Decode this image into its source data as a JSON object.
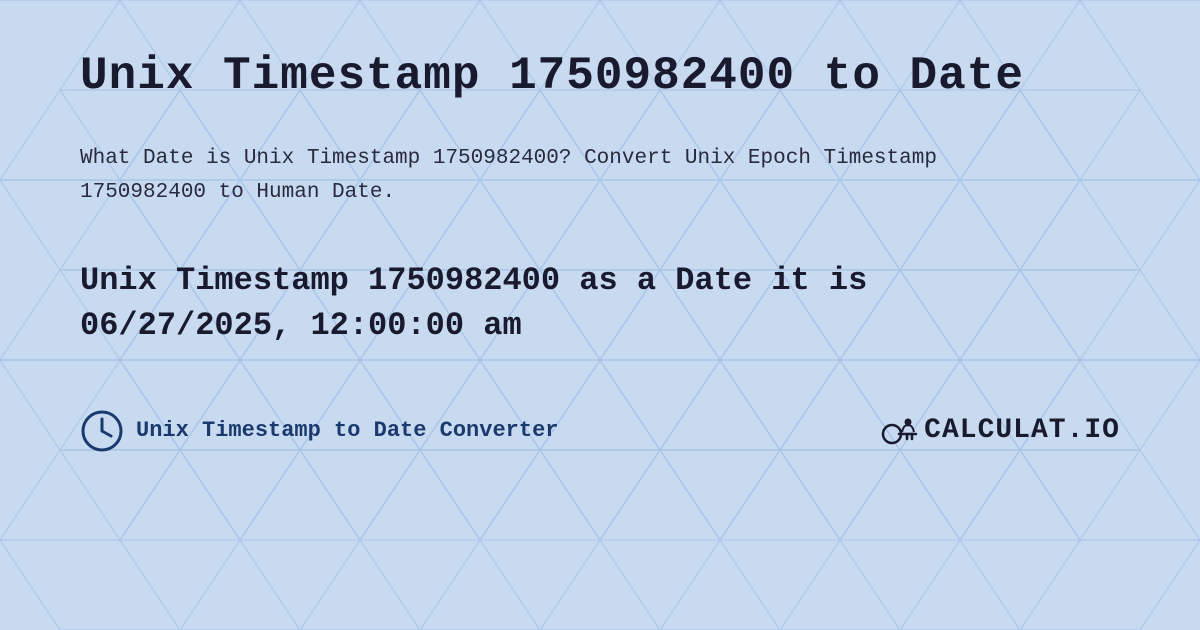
{
  "page": {
    "title": "Unix Timestamp 1750982400 to Date",
    "description": "What Date is Unix Timestamp 1750982400? Convert Unix Epoch Timestamp 1750982400 to Human Date.",
    "result_line1": "Unix Timestamp 1750982400 as a Date it is",
    "result_line2": "06/27/2025, 12:00:00 am",
    "footer": {
      "label": "Unix Timestamp to Date Converter",
      "logo_text": "CALCULAT.IO"
    },
    "background_color": "#c8daf0",
    "accent_color": "#1a3a6e"
  }
}
